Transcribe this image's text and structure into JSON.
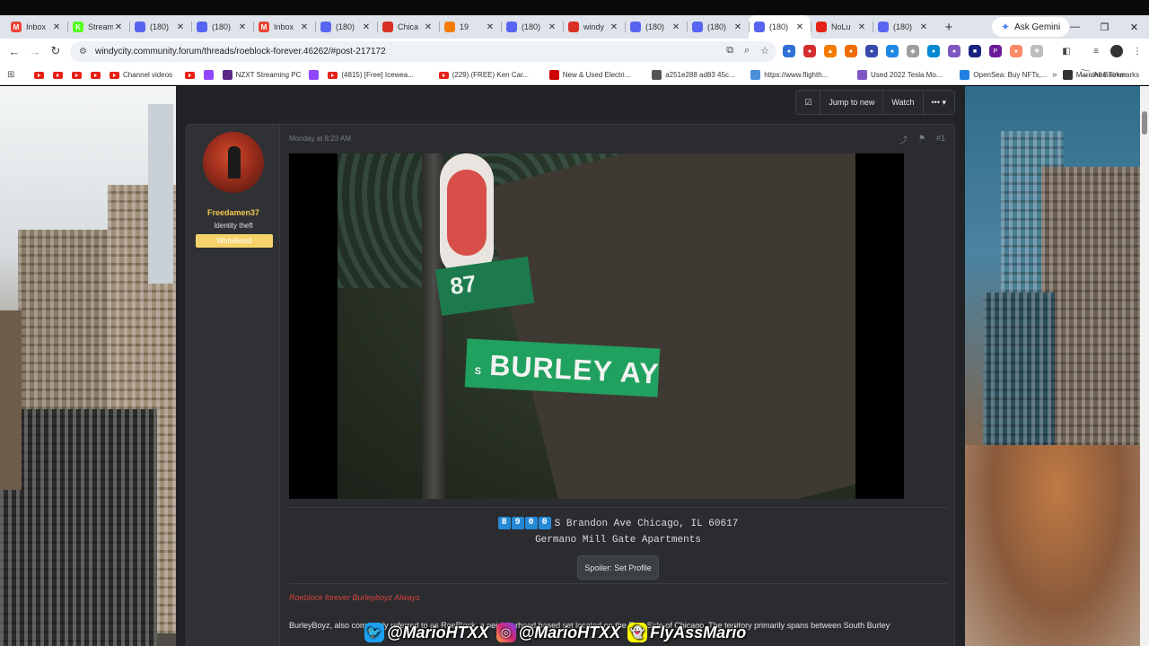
{
  "tabs": [
    {
      "title": "Inbox",
      "favicon_color": "#ea4335",
      "favicon_glyph": "M"
    },
    {
      "title": "Stream",
      "favicon_color": "#53fc18",
      "favicon_glyph": "K"
    },
    {
      "title": "(180)",
      "favicon_color": "#5865f2",
      "favicon_glyph": ""
    },
    {
      "title": "(180)",
      "favicon_color": "#5865f2",
      "favicon_glyph": ""
    },
    {
      "title": "Inbox",
      "favicon_color": "#ea4335",
      "favicon_glyph": "M"
    },
    {
      "title": "(180)",
      "favicon_color": "#5865f2",
      "favicon_glyph": ""
    },
    {
      "title": "Chica",
      "favicon_color": "#d93025",
      "favicon_glyph": ""
    },
    {
      "title": "19",
      "favicon_color": "#f57c00",
      "favicon_glyph": ""
    },
    {
      "title": "(180)",
      "favicon_color": "#5865f2",
      "favicon_glyph": ""
    },
    {
      "title": "windy",
      "favicon_color": "#d93025",
      "favicon_glyph": ""
    },
    {
      "title": "(180)",
      "favicon_color": "#5865f2",
      "favicon_glyph": ""
    },
    {
      "title": "(180)",
      "favicon_color": "#5865f2",
      "favicon_glyph": ""
    },
    {
      "title": "(180)",
      "favicon_color": "#5865f2",
      "favicon_glyph": "",
      "active": true
    },
    {
      "title": "NoLu",
      "favicon_color": "#e62117",
      "favicon_glyph": ""
    },
    {
      "title": "(180)",
      "favicon_color": "#5865f2",
      "favicon_glyph": ""
    }
  ],
  "ask_gemini": "Ask Gemini",
  "url": "windycity.community.forum/threads/roeblock-forever.46262/#post-217172",
  "bookmarks": [
    {
      "label": "",
      "type": "yt"
    },
    {
      "label": "",
      "type": "yt"
    },
    {
      "label": "",
      "type": "yt"
    },
    {
      "label": "",
      "type": "yt"
    },
    {
      "label": "Channel videos",
      "type": "yt"
    },
    {
      "label": "",
      "type": "yt"
    },
    {
      "label": "",
      "type": "twitch"
    },
    {
      "label": "NZXT Streaming PC",
      "type": "nzxt"
    },
    {
      "label": "",
      "type": "twitch"
    },
    {
      "label": "(4815) [Free] Icewea...",
      "type": "yt"
    },
    {
      "label": "(229) (FREE) Ken Car...",
      "type": "yt"
    },
    {
      "label": "New & Used Electri...",
      "type": "tesla"
    },
    {
      "label": "a251e288 ad83 45c...",
      "type": "link"
    },
    {
      "label": "https://www.flighth...",
      "type": "flight"
    },
    {
      "label": "Used 2022 Tesla Mo...",
      "type": "tesla2"
    },
    {
      "label": "OpenSea: Buy NFTs,...",
      "type": "opensea"
    },
    {
      "label": "Marathon Timer",
      "type": "timer"
    }
  ],
  "all_bookmarks": "All Bookmarks",
  "thread_actions": {
    "jump": "Jump to new",
    "watch": "Watch",
    "more": "•••"
  },
  "post": {
    "username": "Freedamen37",
    "user_title": "Identity theft",
    "user_badge": "Whitelisted",
    "date": "Monday at 8:23 AM",
    "post_number": "#1",
    "video": {
      "sign_top": "87",
      "sign_main": "BURLEY AY",
      "sign_prefix": "S"
    },
    "address_digits": [
      "8",
      "9",
      "0",
      "0"
    ],
    "address_rest": "S Brandon Ave Chicago, IL 60617",
    "address_line2": "Germano Mill Gate Apartments",
    "spoiler_label": "Spoiler: Set Profile",
    "quote": "Roeblock forever Burleyboyz Always",
    "body_start": "BurleyBoyz, also commonly referred to as RoeBlock, a neighborhood based set located on the East Side of Chicago. The territory primarily spans between South Burley"
  },
  "overlay": {
    "twitter": "@MarioHTXX",
    "instagram": "@MarioHTXX",
    "snapchat": "FlyAssMario"
  },
  "colors": {
    "username": "#f2c84b",
    "badge": "#f6d36a",
    "quote": "#d7433c",
    "digit_bg": "#2689d6"
  }
}
